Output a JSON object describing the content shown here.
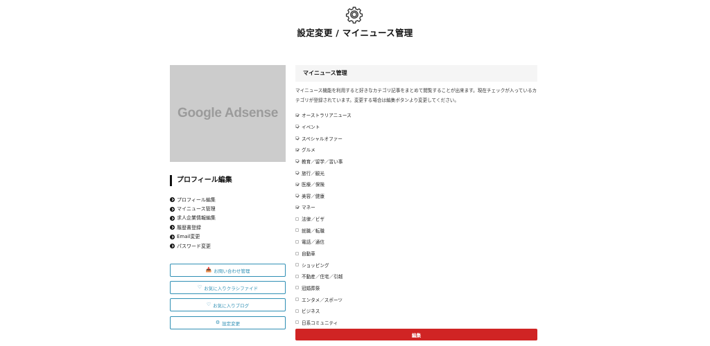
{
  "header": {
    "icon": "gear-icon",
    "title": "設定変更 / マイニュース管理"
  },
  "ad": {
    "text": "Google Adsense"
  },
  "sidebar": {
    "heading": "プロフィール編集",
    "links": [
      {
        "label": "プロフィール編集",
        "icon": "arrow-circle-right-icon"
      },
      {
        "label": "マイニュース管理",
        "icon": "arrow-circle-right-icon"
      },
      {
        "label": "求人企業情報編集",
        "icon": "arrow-circle-right-icon"
      },
      {
        "label": "履歴書登録",
        "icon": "arrow-circle-right-icon"
      },
      {
        "label": "Email変更",
        "icon": "arrow-circle-right-icon"
      },
      {
        "label": "パスワード変更",
        "icon": "arrow-circle-right-icon"
      }
    ],
    "buttons": [
      {
        "label": "お問い合わせ管理",
        "icon": "inbox-icon"
      },
      {
        "label": "お気に入りクラシファイド",
        "icon": "heart-icon"
      },
      {
        "label": "お気に入りブログ",
        "icon": "heart-icon"
      },
      {
        "label": "設定変更",
        "icon": "gear-icon"
      }
    ]
  },
  "main": {
    "heading": "マイニュース管理",
    "description": "マイニュース機能を利用すると好きなカテゴリ記事をまとめて閲覧することが出来ます。現在チェックが入っているカテゴリが登録されています。変更する場合は編集ボタンより変更してください。",
    "categories": [
      {
        "label": "オーストラリアニュース",
        "checked": true
      },
      {
        "label": "イベント",
        "checked": true
      },
      {
        "label": "スペシャルオファー",
        "checked": true
      },
      {
        "label": "グルメ",
        "checked": true
      },
      {
        "label": "教育／留学／習い事",
        "checked": true
      },
      {
        "label": "旅行／観光",
        "checked": true
      },
      {
        "label": "医療／保険",
        "checked": true
      },
      {
        "label": "美容／健康",
        "checked": true
      },
      {
        "label": "マネー",
        "checked": true
      },
      {
        "label": "法律／ビザ",
        "checked": false
      },
      {
        "label": "就職／転職",
        "checked": false
      },
      {
        "label": "電話／通信",
        "checked": false
      },
      {
        "label": "自動車",
        "checked": false
      },
      {
        "label": "ショッピング",
        "checked": false
      },
      {
        "label": "不動産／住宅／引越",
        "checked": false
      },
      {
        "label": "冠婚葬祭",
        "checked": false
      },
      {
        "label": "エンタメ／スポーツ",
        "checked": false
      },
      {
        "label": "ビジネス",
        "checked": false
      },
      {
        "label": "日系コミュニティ",
        "checked": false
      }
    ],
    "edit_button": "編集"
  },
  "colors": {
    "accent_blue": "#2f8fb4",
    "edit_red": "#d02424",
    "ad_gray": "#cccccc"
  }
}
